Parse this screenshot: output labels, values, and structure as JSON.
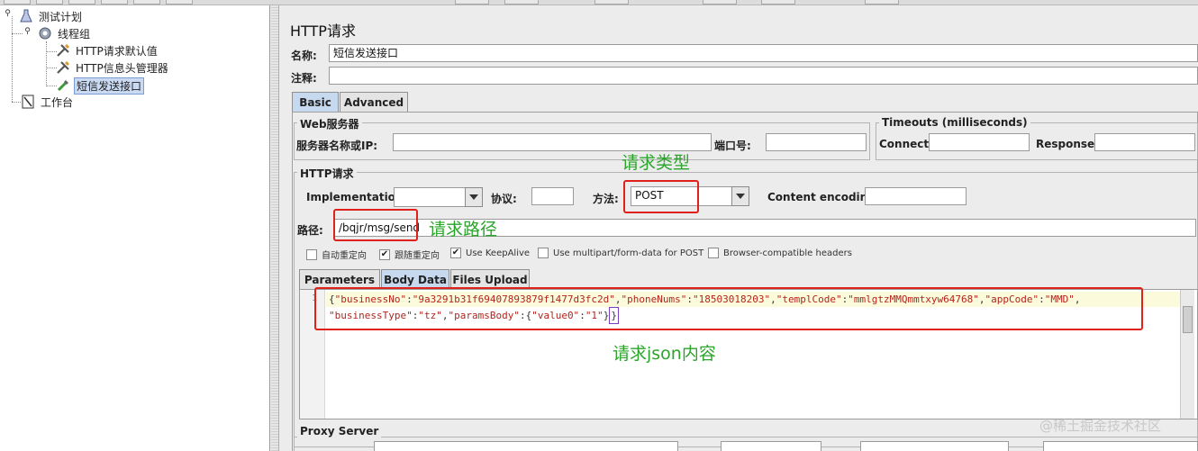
{
  "toolbar": {
    "segments": 12
  },
  "tree": {
    "items": [
      {
        "label": "测试计划",
        "icon": "flask-icon"
      },
      {
        "label": "线程组",
        "icon": "gear-icon"
      },
      {
        "label": "HTTP请求默认值",
        "icon": "wrench-icon"
      },
      {
        "label": "HTTP信息头管理器",
        "icon": "wrench-icon"
      },
      {
        "label": "短信发送接口",
        "icon": "pipette-icon"
      },
      {
        "label": "工作台",
        "icon": "workbench-icon"
      }
    ]
  },
  "panel": {
    "title": "HTTP请求",
    "name_label": "名称:",
    "name_value": "短信发送接口",
    "comment_label": "注释:",
    "comment_value": "",
    "tabs": [
      {
        "label": "Basic",
        "active": true
      },
      {
        "label": "Advanced",
        "active": false
      }
    ],
    "web_server": {
      "group_title": "Web服务器",
      "server_label": "服务器名称或IP:",
      "server_value": "",
      "port_label": "端口号:",
      "port_value": ""
    },
    "timeouts": {
      "group_title": "Timeouts (milliseconds)",
      "connect_label": "Connect:",
      "connect_value": "",
      "response_label": "Response:",
      "response_value": ""
    },
    "http_request": {
      "group_title": "HTTP请求",
      "implementation_label": "Implementation:",
      "implementation_value": "",
      "protocol_label": "协议:",
      "protocol_value": "",
      "method_label": "方法:",
      "method_value": "POST",
      "encoding_label": "Content encoding:",
      "encoding_value": "",
      "path_label": "路径:",
      "path_value": "/bqjr/msg/send"
    },
    "checkboxes": [
      {
        "label": "自动重定向",
        "checked": false
      },
      {
        "label": "跟随重定向",
        "checked": true
      },
      {
        "label": "Use KeepAlive",
        "checked": true
      },
      {
        "label": "Use multipart/form-data for POST",
        "checked": false
      },
      {
        "label": "Browser-compatible headers",
        "checked": false
      }
    ],
    "subtabs": [
      {
        "label": "Parameters",
        "active": false
      },
      {
        "label": "Body Data",
        "active": true
      },
      {
        "label": "Files Upload",
        "active": false
      }
    ],
    "body": {
      "line_number": "1",
      "line1": [
        {
          "t": "{",
          "c": "p"
        },
        {
          "t": "\"businessNo\"",
          "c": "k"
        },
        {
          "t": ":",
          "c": "p"
        },
        {
          "t": "\"9a3291b31f69407893879f1477d3fc2d\"",
          "c": "k"
        },
        {
          "t": ",",
          "c": "p"
        },
        {
          "t": "\"phoneNums\"",
          "c": "k"
        },
        {
          "t": ":",
          "c": "p"
        },
        {
          "t": "\"18503018203\"",
          "c": "k"
        },
        {
          "t": ",",
          "c": "p"
        },
        {
          "t": "\"templCode\"",
          "c": "k"
        },
        {
          "t": ":",
          "c": "p"
        },
        {
          "t": "\"mmlgtzMMQmmtxyw64768\"",
          "c": "k"
        },
        {
          "t": ",",
          "c": "p"
        },
        {
          "t": "\"appCode\"",
          "c": "k"
        },
        {
          "t": ":",
          "c": "p"
        },
        {
          "t": "\"MMD\"",
          "c": "k"
        },
        {
          "t": ",",
          "c": "p"
        }
      ],
      "line2": [
        {
          "t": "\"businessType\"",
          "c": "k"
        },
        {
          "t": ":",
          "c": "p"
        },
        {
          "t": "\"tz\"",
          "c": "k"
        },
        {
          "t": ",",
          "c": "p"
        },
        {
          "t": "\"paramsBody\"",
          "c": "k"
        },
        {
          "t": ":{",
          "c": "p"
        },
        {
          "t": "\"value0\"",
          "c": "k"
        },
        {
          "t": ":",
          "c": "p"
        },
        {
          "t": "\"1\"",
          "c": "k"
        },
        {
          "t": "}",
          "c": "p"
        }
      ],
      "caret_char": "}"
    },
    "proxy": {
      "group_title": "Proxy Server"
    }
  },
  "annotations": {
    "method": "请求类型",
    "path": "请求路径",
    "json": "请求json内容"
  },
  "watermark": "@稀土掘金技术社区",
  "colors": {
    "annotation": "#2aa52a",
    "highlight_box": "#e0201a",
    "json_key": "#b5231c",
    "tab_active": "#c7d9ee"
  }
}
